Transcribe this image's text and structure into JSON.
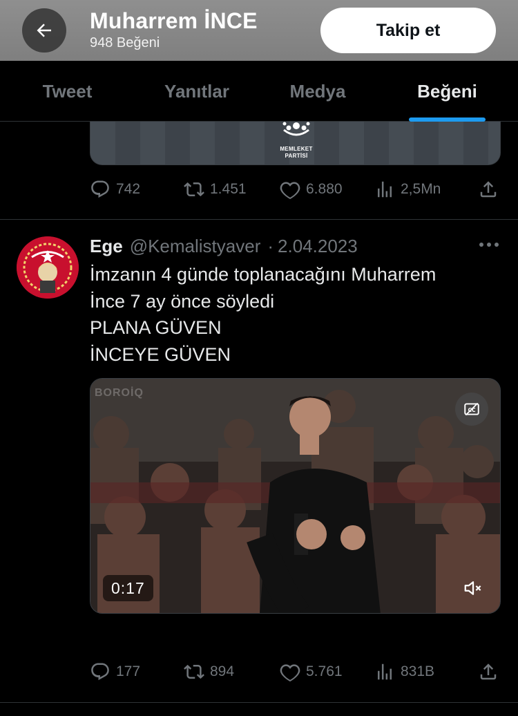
{
  "header": {
    "title": "Muharrem İNCE",
    "subtitle": "948 Beğeni",
    "follow_label": "Takip et",
    "bg_color": "#8a8a8a"
  },
  "tabs": [
    {
      "label": "Tweet",
      "active": false
    },
    {
      "label": "Yanıtlar",
      "active": false
    },
    {
      "label": "Medya",
      "active": false
    },
    {
      "label": "Beğeni",
      "active": true
    }
  ],
  "accent_color": "#1d9bf0",
  "prev_tweet": {
    "image_logo_text_1": "MEMLEKET",
    "image_logo_text_2": "PARTİSİ",
    "stats": {
      "replies": "742",
      "retweets": "1.451",
      "likes": "6.880",
      "views": "2,5Mn"
    }
  },
  "tweet": {
    "name": "Ege",
    "handle": "@Kemalistyaver",
    "separator": "·",
    "date": "2.04.2023",
    "text_lines": [
      "İmzanın 4 günde toplanacağını Muharrem",
      "İnce 7 ay önce söyledi",
      "PLANA GÜVEN",
      "İNCEYE GÜVEN"
    ],
    "video": {
      "duration": "0:17",
      "watermark": "BOROİQ"
    },
    "stats": {
      "replies": "177",
      "retweets": "894",
      "likes": "5.761",
      "views": "831B"
    }
  },
  "icons": {
    "back": "arrow-left-icon",
    "reply": "reply-icon",
    "retweet": "retweet-icon",
    "like": "heart-icon",
    "views": "views-icon",
    "share": "share-icon",
    "more": "more-icon",
    "captions": "captions-icon",
    "mute": "mute-icon"
  }
}
